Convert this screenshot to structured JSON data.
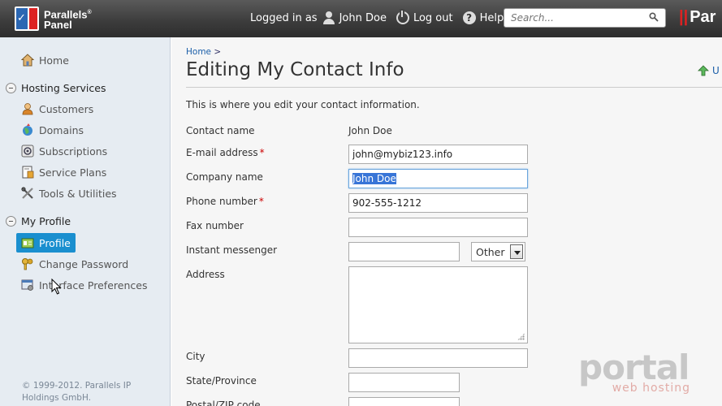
{
  "header": {
    "logo_line1": "Parallels",
    "logo_line2": "Panel",
    "logged_in_label": "Logged in as",
    "user_name": "John Doe",
    "logout_label": "Log out",
    "help_label": "Help",
    "search_placeholder": "Search...",
    "brand_right": "Par"
  },
  "sidebar": {
    "home": "Home",
    "hosting_section": "Hosting Services",
    "hosting_items": [
      "Customers",
      "Domains",
      "Subscriptions",
      "Service Plans",
      "Tools & Utilities"
    ],
    "profile_section": "My Profile",
    "profile_items": [
      "Profile",
      "Change Password",
      "Interface Preferences"
    ],
    "copyright": "© 1999-2012. Parallels IP Holdings GmbH."
  },
  "main": {
    "breadcrumb_home": "Home",
    "breadcrumb_sep": ">",
    "title": "Editing My Contact Info",
    "up_label": "U",
    "intro": "This is where you edit your contact information.",
    "fields": {
      "contact_name_label": "Contact name",
      "contact_name_value": "John Doe",
      "email_label": "E-mail address",
      "email_value": "john@mybiz123.info",
      "company_label": "Company name",
      "company_value": "John Doe",
      "phone_label": "Phone number",
      "phone_value": "902-555-1212",
      "fax_label": "Fax number",
      "fax_value": "",
      "im_label": "Instant messenger",
      "im_value": "",
      "im_type": "Other",
      "address_label": "Address",
      "city_label": "City",
      "state_label": "State/Province",
      "zip_label": "Postal/ZIP code"
    },
    "required_mark": "*"
  },
  "watermark": {
    "main": "portal",
    "sub": "web hosting"
  },
  "colors": {
    "header_bg": "#3b3b3b",
    "sidebar_bg": "#e6ecf2",
    "active_item": "#1a8fcf",
    "selection": "#3875d7",
    "required": "#cc0000"
  }
}
